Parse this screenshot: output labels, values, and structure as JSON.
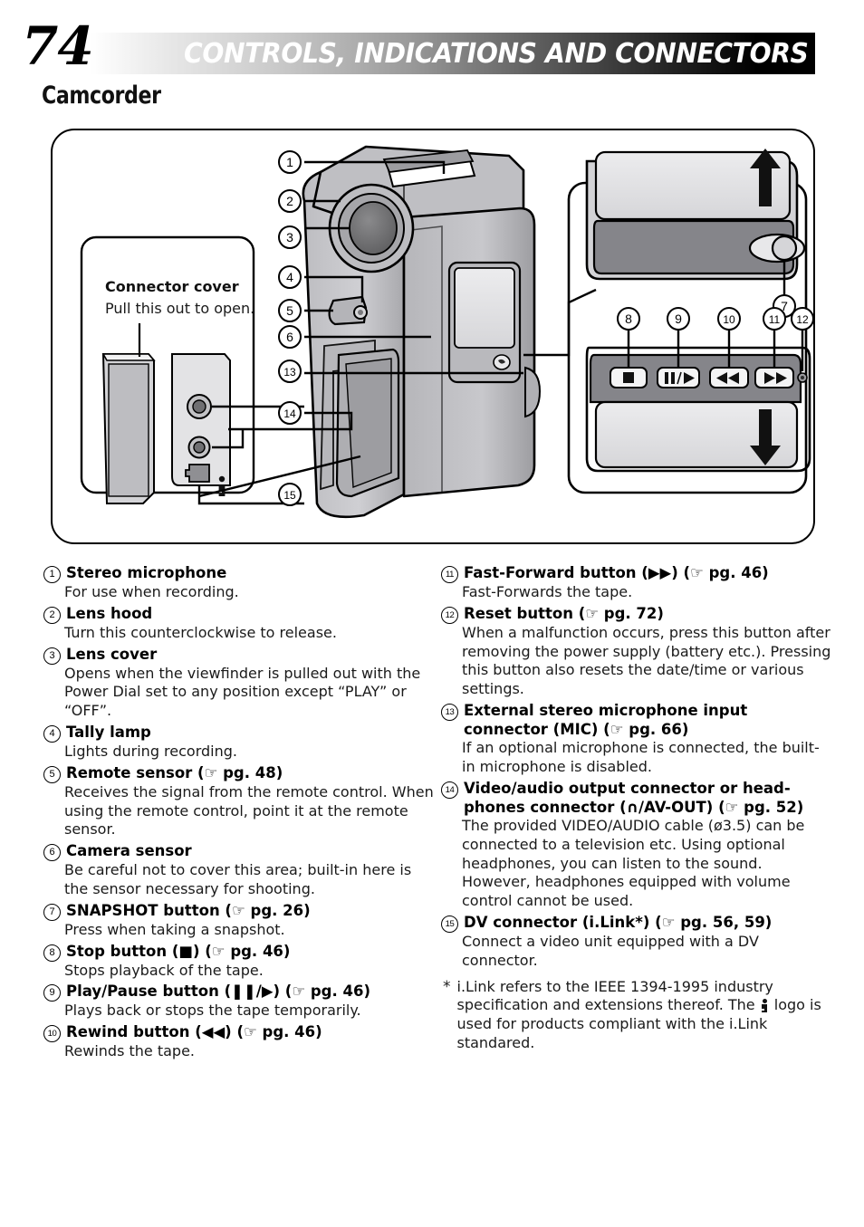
{
  "header": {
    "page_number": "74",
    "title": "CONTROLS, INDICATIONS AND CONNECTORS",
    "section_title": "Camcorder"
  },
  "diagram": {
    "callout_numbers": [
      "1",
      "2",
      "3",
      "4",
      "5",
      "6",
      "7",
      "8",
      "9",
      "10",
      "11",
      "12",
      "13",
      "14",
      "15"
    ],
    "connector_cover_label": "Connector cover",
    "connector_cover_instruction": "Pull this out to open.",
    "buttons": {
      "stop_glyph": "■",
      "play_pause_glyph": "❚❚/▶",
      "rewind_glyph": "◀◀",
      "forward_glyph": "▶▶"
    },
    "arrow_up": "↑",
    "arrow_down": "↓",
    "colors": {
      "body_light": "#c9c9cc",
      "body_mid": "#a8a8ac",
      "body_dark": "#86868a",
      "panel_gray": "#8c8c8e",
      "screen": "#e4e4e6",
      "outline": "#000000"
    }
  },
  "items_left": [
    {
      "num": "1",
      "title": "Stereo microphone",
      "desc": "For use when recording."
    },
    {
      "num": "2",
      "title": "Lens hood",
      "desc": "Turn this counterclockwise to release."
    },
    {
      "num": "3",
      "title": "Lens cover",
      "desc": "Opens when the viewfinder is pulled out with the Power Dial set to any position except “PLAY” or “OFF”."
    },
    {
      "num": "4",
      "title": "Tally lamp",
      "desc": "Lights during recording."
    },
    {
      "num": "5",
      "title": "Remote sensor (☞ pg. 48)",
      "desc": "Receives the signal from the remote control. When using the remote control, point it at the remote sensor."
    },
    {
      "num": "6",
      "title": "Camera sensor",
      "desc": "Be careful not to cover this area; built-in here is the sensor necessary for shooting."
    },
    {
      "num": "7",
      "title": "SNAPSHOT button (☞ pg. 26)",
      "desc": "Press when taking a snapshot."
    },
    {
      "num": "8",
      "title": "Stop button (■) (☞ pg. 46)",
      "desc": "Stops playback of the tape."
    },
    {
      "num": "9",
      "title": "Play/Pause button (❚❚/▶) (☞ pg. 46)",
      "desc": "Plays back or stops the tape temporarily."
    },
    {
      "num": "10",
      "title": "Rewind button (◀◀) (☞ pg. 46)",
      "desc": "Rewinds the tape."
    }
  ],
  "items_right": [
    {
      "num": "11",
      "title": "Fast-Forward button (▶▶) (☞ pg. 46)",
      "desc": "Fast-Forwards the tape."
    },
    {
      "num": "12",
      "title": "Reset button (☞ pg. 72)",
      "desc": "When a malfunction occurs, press this button after removing the power supply (battery etc.). Pressing this button also resets the date/time or various settings."
    },
    {
      "num": "13",
      "title": "External stereo microphone input connector (MIC) (☞ pg. 66)",
      "desc": "If an optional microphone is connected, the built-in microphone is disabled."
    },
    {
      "num": "14",
      "title": "Video/audio output connector or head-phones connector (∩/AV-OUT) (☞ pg. 52)",
      "desc": "The provided VIDEO/AUDIO cable (ø3.5) can be connected to a television etc. Using optional headphones, you can listen to the sound. However, headphones equipped with volume control cannot be used."
    },
    {
      "num": "15",
      "title": "DV connector (i.Link*) (☞ pg. 56, 59)",
      "desc": "Connect a video unit equipped with a DV connector."
    }
  ],
  "footnote": {
    "marker": "*",
    "text_before_logo": "i.Link refers to the IEEE 1394-1995 industry specification and extensions thereof. The ",
    "text_after_logo": " logo is used for products compliant with the i.Link standared."
  }
}
